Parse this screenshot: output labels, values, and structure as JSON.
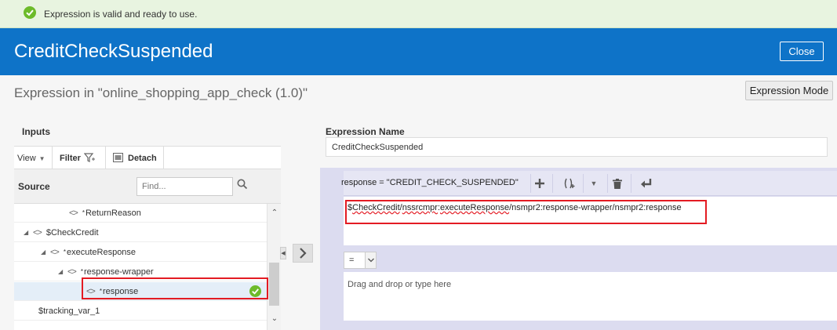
{
  "banner": {
    "message": "Expression is valid and ready to use."
  },
  "header": {
    "title": "CreditCheckSuspended",
    "close_label": "Close"
  },
  "expression_heading": "Expression in \"online_shopping_app_check (1.0)\"",
  "mode_button_label": "Expression Mode",
  "inputs": {
    "title": "Inputs",
    "toolbar": {
      "view_label": "View",
      "filter_label": "Filter",
      "detach_label": "Detach"
    },
    "source_label": "Source",
    "find_placeholder": "Find...",
    "tree": [
      {
        "label": "ReturnReason",
        "required": true,
        "tag": "<>",
        "expanded": null
      },
      {
        "label": "$CheckCredit",
        "required": false,
        "tag": "<>",
        "expanded": true
      },
      {
        "label": "executeResponse",
        "required": true,
        "tag": "<>",
        "expanded": true
      },
      {
        "label": "response-wrapper",
        "required": true,
        "tag": "<>",
        "expanded": true
      },
      {
        "label": "response",
        "required": true,
        "tag": "<>",
        "selected": true,
        "valid": true
      },
      {
        "label": "$tracking_var_1",
        "required": false,
        "tag": "",
        "expanded": null
      }
    ]
  },
  "expression_name": {
    "label": "Expression Name",
    "value": "CreditCheckSuspended"
  },
  "editor": {
    "assignment": "response = \"CREDIT_CHECK_SUSPENDED\"",
    "expression_parts": [
      "$",
      "CheckCredit",
      "/",
      "nssrcmpr",
      ":",
      "executeResponse",
      "/nsmpr2:response-wrapper/nsmpr2:response"
    ],
    "operator": "=",
    "drop_placeholder": "Drag and drop or type here"
  },
  "colors": {
    "brand": "#0e73c8",
    "success": "#6dbb2a",
    "highlight": "#e31b23"
  }
}
